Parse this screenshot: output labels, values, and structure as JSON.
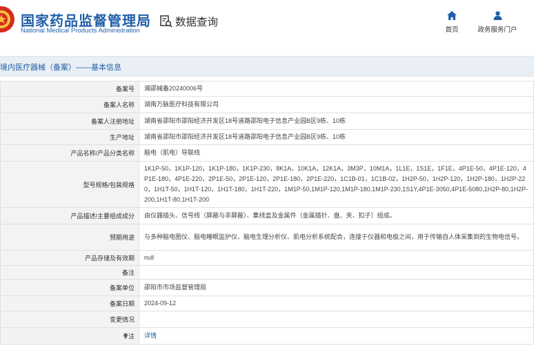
{
  "header": {
    "title_cn": "国家药品监督管理局",
    "title_en": "National Medical Products Administration",
    "query_label": "数据查询"
  },
  "nav": {
    "home_label": "首页",
    "gov_label": "政务服务门户"
  },
  "section": {
    "title": "境内医疗器械（备案）——基本信息"
  },
  "rows": [
    {
      "label": "备案号",
      "value": "湘邵械备20240006号"
    },
    {
      "label": "备案人名称",
      "value": "湖南万脉医疗科技有限公司"
    },
    {
      "label": "备案人注册地址",
      "value": "湖南省邵阳市邵阳经济开发区18号道路邵阳电子信息产业园B区9栋、10栋"
    },
    {
      "label": "生产地址",
      "value": "湖南省邵阳市邵阳经济开发区18号道路邵阳电子信息产业园B区9栋、10栋"
    },
    {
      "label": "产品名称/产品分类名称",
      "value": "脑电（肌电）导联线"
    },
    {
      "label": "型号规格/包装规格",
      "value": "1K1P-50，1K1P-120，1K1P-180，1K1P-230，8K1A，10K1A，12K1A，3M3P，10M1A，1L1E，1S1E，1F1E，4P1E-50，4P1E-120，4P1E-180，4P1E-220，2P1E-50，2P1E-120，2P1E-180，2P1E-220，1C1B-01，1C1B-02，1H2P-50，1H2P-120，1H2P-180，1H2P-220，1H1T-50，1H1T-120，1H1T-180，1H1T-220，1M1P-50,1M1P-120,1M1P-180,1M1P-230,1S1Y,4P1E-3050,4P1E-5080,1H2P-80,1H2P-200,1H1T-80,1H1T-200"
    },
    {
      "label": "产品描述/主要组成成分",
      "value": "由仪器插头、信号线（屏蔽与非屏蔽）、集线盒及金属件（金属插针、盘、夹、扣子）组成。"
    },
    {
      "label": "预期用途",
      "value": "与多种脑电图仪、脑电睡眠监护仪、脑电生理分析仪、肌电分析系统配合，连接于仪器和电极之间，用于传输自人体采集到的生物电信号。"
    },
    {
      "label": "产品存储及有效期",
      "value": "null"
    },
    {
      "label": "备注",
      "value": ""
    },
    {
      "label": "备案单位",
      "value": "邵阳市市场监督管理局"
    },
    {
      "label": "备案日期",
      "value": "2024-09-12"
    },
    {
      "label": "变更情况",
      "value": ""
    },
    {
      "label": "注",
      "value": "详情"
    }
  ],
  "colors": {
    "brand_blue": "#1f5fa8",
    "label_bg": "#f3f3f3",
    "section_bg": "#e9eff5"
  },
  "icons": {
    "logo": "national-emblem-icon",
    "query": "search-document-icon",
    "home": "home-icon",
    "gov": "user-icon",
    "note": "bulb-icon"
  }
}
